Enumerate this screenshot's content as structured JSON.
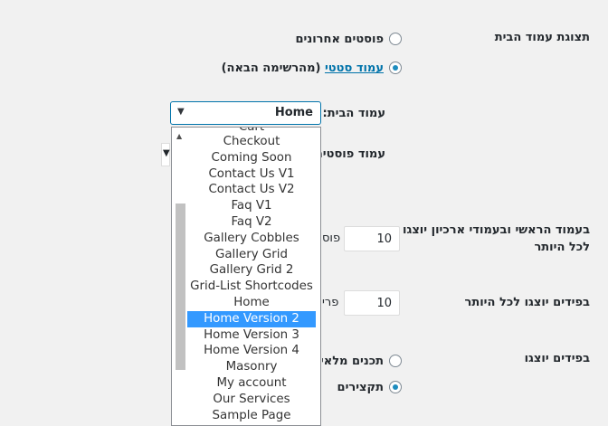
{
  "homepage_display": {
    "section_label": "תצוגת עמוד הבית",
    "option_latest": "פוסטים אחרונים",
    "option_static_link": "עמוד סטטי",
    "option_static_suffix": " (מהרשימה הבאה)",
    "homepage_label": "עמוד הבית:",
    "homepage_selected": "Home",
    "posts_page_label": "עמוד פוסטים"
  },
  "dropdown": {
    "partial_top_item": "Cart",
    "items": [
      "Checkout",
      "Coming Soon",
      "Contact Us V1",
      "Contact Us V2",
      "Faq V1",
      "Faq V2",
      "Gallery Cobbles",
      "Gallery Grid",
      "Gallery Grid 2",
      "Grid-List Shortcodes",
      "Home",
      "Home Version 2",
      "Home Version 3",
      "Home Version 4",
      "Masonry",
      "My account",
      "Our Services",
      "Sample Page"
    ],
    "selected_index": 11
  },
  "blog_pages": {
    "label_line1": "בעמוד הראשי ובעמודי ארכיון יוצגו",
    "label_line2": "לכל היותר",
    "value": "10",
    "unit": "פוס"
  },
  "feed": {
    "label": "בפידים יוצגו לכל היותר",
    "value": "10",
    "unit": "פרי"
  },
  "feed_content": {
    "label": "בפידים יוצגו",
    "option_full": "תכנים מלאים",
    "option_summary": "תקצירים"
  }
}
